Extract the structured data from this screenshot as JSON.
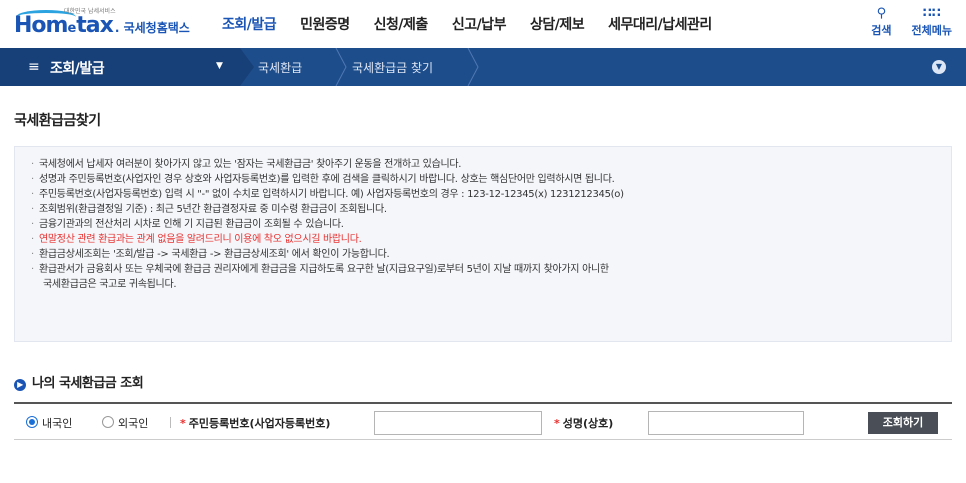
{
  "logo": {
    "small": "대한민국 납세서비스",
    "w1": "Hom",
    "w2": "e",
    "w3": "tax",
    "w4": ". 국세청홈택스"
  },
  "gnb": [
    "조회/발급",
    "민원증명",
    "신청/제출",
    "신고/납부",
    "상담/제보",
    "세무대리/납세관리"
  ],
  "util": {
    "search": "검색",
    "menu": "전체메뉴"
  },
  "bar": {
    "menu_label": "조회/발급",
    "crumb1": "국세환급",
    "crumb2": "국세환급금 찾기"
  },
  "page_title": "국세환급금찾기",
  "info": [
    "국세청에서 납세자 여러분이 찾아가지 않고 있는 '잠자는 국세환급금' 찾아주기 운동을 전개하고 있습니다.",
    "성명과 주민등록번호(사업자인 경우 상호와 사업자등록번호)를 입력한 후에 검색을 클릭하시기 바랍니다. 상호는 핵심단어만 입력하시면 됩니다.",
    "주민등록번호(사업자등록번호) 입력 시 \"-\" 없이 수치로 입력하시기 바랍니다. 예) 사업자등록번호의 경우 : 123-12-12345(x) 1231212345(o)",
    "조회범위(환급결정일 기준) : 최근 5년간 환급결정자료 중 미수령 환급금이 조회됩니다.",
    "금융기관과의 전산처리 시차로 인해 기 지급된 환급금이 조회될 수 있습니다.",
    "연말정산 관련 환급과는 관계 없음을 알려드리니 이용에 착오 없으시길 바랍니다.",
    "환급금상세조회는 '조회/발급 -> 국세환급 -> 환급금상세조회' 에서 확인이 가능합니다.",
    "환급관서가 금융회사 또는 우체국에 환급금 권리자에게 환급금을 지급하도록 요구한 날(지급요구일)로부터 5년이 지날 때까지 찾아가지 아니한",
    "국세환급금은 국고로 귀속됩니다."
  ],
  "section_title": "나의 국세환급금 조회",
  "search": {
    "radio_domestic": "내국인",
    "radio_foreign": "외국인",
    "id_label": "주민등록번호(사업자등록번호)",
    "name_label": "성명(상호)",
    "id_value": "",
    "name_value": "",
    "button": "조회하기"
  },
  "colors": {
    "brand": "#1a55b5",
    "bar": "#1e4d8c",
    "warning": "#e8302f"
  }
}
